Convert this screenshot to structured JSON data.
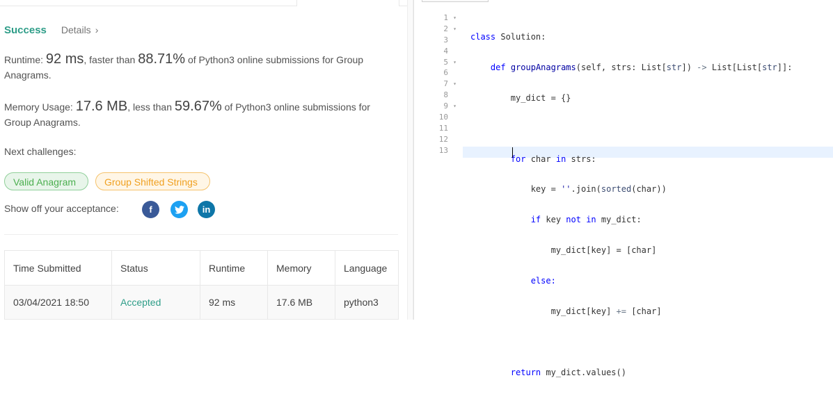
{
  "result": {
    "status": "Success",
    "details_label": "Details",
    "details_chevron": "›"
  },
  "runtime": {
    "label": "Runtime: ",
    "value": "92 ms",
    "mid": ", faster than ",
    "percent": "88.71%",
    "tail": " of Python3 online submissions for Group Anagrams."
  },
  "memory": {
    "label": "Memory Usage: ",
    "value": "17.6 MB",
    "mid": ", less than ",
    "percent": "59.67%",
    "tail": " of Python3 online submissions for Group Anagrams."
  },
  "next": {
    "label": "Next challenges:",
    "items": [
      "Valid Anagram",
      "Group Shifted Strings"
    ]
  },
  "share": {
    "label": "Show off your acceptance:",
    "facebook": "f",
    "linkedin": "in"
  },
  "table": {
    "headers": [
      "Time Submitted",
      "Status",
      "Runtime",
      "Memory",
      "Language"
    ],
    "row": [
      "03/04/2021 18:50",
      "Accepted",
      "92 ms",
      "17.6 MB",
      "python3"
    ]
  },
  "editor": {
    "line_numbers": [
      "1",
      "2",
      "3",
      "4",
      "5",
      "6",
      "7",
      "8",
      "9",
      "10",
      "11",
      "12",
      "13"
    ],
    "fold_marker": "▾",
    "code": {
      "l1_kw": "class",
      "l1_name": " Solution:",
      "l2_kw": "def",
      "l2_fn": " groupAnagrams",
      "l2_a": "(self, strs: List[",
      "l2_t1": "str",
      "l2_b": "]) ",
      "l2_arrow": "->",
      "l2_c": " List[List[",
      "l2_t2": "str",
      "l2_d": "]]:",
      "l3": "my_dict = {}",
      "l5_kw1": "for",
      "l5_a": " char ",
      "l5_kw2": "in",
      "l5_b": " strs:",
      "l6_a": "key = ",
      "l6_s": "''",
      "l6_b": ".join(",
      "l6_f": "sorted",
      "l6_c": "(char))",
      "l7_kw": "if",
      "l7_a": " key ",
      "l7_kw2": "not",
      "l7_sp": " ",
      "l7_kw3": "in",
      "l7_b": " my_dict:",
      "l8": "my_dict[key] = [char]",
      "l9": "else:",
      "l10_a": "my_dict[key] ",
      "l10_op": "+=",
      "l10_b": " [char]",
      "l12_kw": "return",
      "l12_a": " my_dict.values()"
    }
  }
}
